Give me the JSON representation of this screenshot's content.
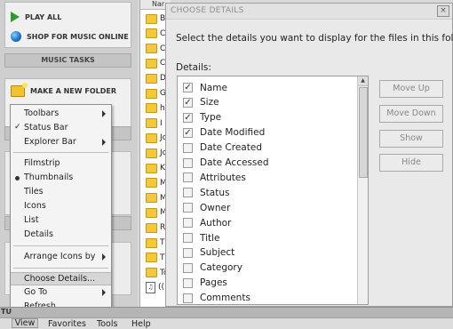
{
  "tasks": {
    "play_all": "PLAY ALL",
    "shop_music": "SHOP FOR MUSIC ONLINE",
    "music_tasks_header": "MUSIC TASKS",
    "make_new_folder": "MAKE A NEW FOLDER"
  },
  "file_list": {
    "column_header": "Nar",
    "rows": [
      "B",
      "C",
      "C",
      "C",
      "D",
      "G",
      "h",
      "I",
      "Jc",
      "Jc",
      "K",
      "M",
      "M",
      "M",
      "R",
      "Ti",
      "Ti",
      "Tc",
      "(("
    ]
  },
  "dialog": {
    "title": "CHOOSE DETAILS",
    "close_glyph": "×",
    "instruction": "Select the details you want to display for the files in this folder.",
    "details_label": "Details:",
    "items": [
      {
        "label": "Name",
        "checked": true
      },
      {
        "label": "Size",
        "checked": true
      },
      {
        "label": "Type",
        "checked": true
      },
      {
        "label": "Date Modified",
        "checked": true
      },
      {
        "label": "Date Created",
        "checked": false
      },
      {
        "label": "Date Accessed",
        "checked": false
      },
      {
        "label": "Attributes",
        "checked": false
      },
      {
        "label": "Status",
        "checked": false
      },
      {
        "label": "Owner",
        "checked": false
      },
      {
        "label": "Author",
        "checked": false
      },
      {
        "label": "Title",
        "checked": false
      },
      {
        "label": "Subject",
        "checked": false
      },
      {
        "label": "Category",
        "checked": false
      },
      {
        "label": "Pages",
        "checked": false
      },
      {
        "label": "Comments",
        "checked": false
      }
    ],
    "buttons": {
      "move_up": "Move Up",
      "move_down": "Move Down",
      "show": "Show",
      "hide": "Hide"
    },
    "checkmark_glyph": "✓"
  },
  "context_menu": {
    "toolbars": "Toolbars",
    "status_bar": "Status Bar",
    "explorer_bar": "Explorer Bar",
    "filmstrip": "Filmstrip",
    "thumbnails": "Thumbnails",
    "tiles": "Tiles",
    "icons": "Icons",
    "list": "List",
    "details": "Details",
    "arrange_icons_by": "Arrange Icons by",
    "choose_details": "Choose Details...",
    "go_to": "Go To",
    "refresh": "Refresh",
    "check_glyph": "✓"
  },
  "status_bar": {
    "text": "TU"
  },
  "menubar": {
    "view": "View",
    "favorites": "Favorites",
    "tools": "Tools",
    "help": "Help"
  },
  "colors": {
    "play_icon": "#2e9b2e",
    "folder": "#f4c83c",
    "highlight": "#d6d6d6"
  }
}
